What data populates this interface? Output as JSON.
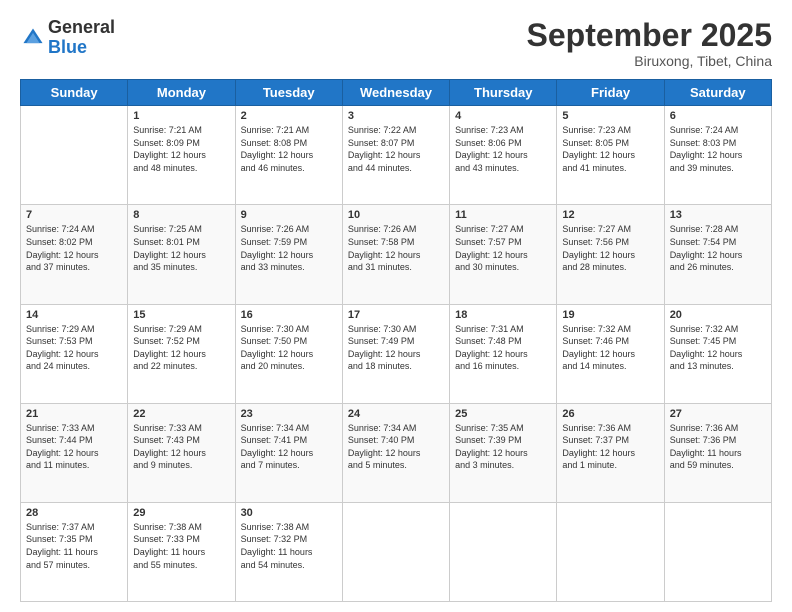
{
  "header": {
    "logo_general": "General",
    "logo_blue": "Blue",
    "month": "September 2025",
    "location": "Biruxong, Tibet, China"
  },
  "days_of_week": [
    "Sunday",
    "Monday",
    "Tuesday",
    "Wednesday",
    "Thursday",
    "Friday",
    "Saturday"
  ],
  "weeks": [
    [
      {
        "day": "",
        "info": ""
      },
      {
        "day": "1",
        "info": "Sunrise: 7:21 AM\nSunset: 8:09 PM\nDaylight: 12 hours\nand 48 minutes."
      },
      {
        "day": "2",
        "info": "Sunrise: 7:21 AM\nSunset: 8:08 PM\nDaylight: 12 hours\nand 46 minutes."
      },
      {
        "day": "3",
        "info": "Sunrise: 7:22 AM\nSunset: 8:07 PM\nDaylight: 12 hours\nand 44 minutes."
      },
      {
        "day": "4",
        "info": "Sunrise: 7:23 AM\nSunset: 8:06 PM\nDaylight: 12 hours\nand 43 minutes."
      },
      {
        "day": "5",
        "info": "Sunrise: 7:23 AM\nSunset: 8:05 PM\nDaylight: 12 hours\nand 41 minutes."
      },
      {
        "day": "6",
        "info": "Sunrise: 7:24 AM\nSunset: 8:03 PM\nDaylight: 12 hours\nand 39 minutes."
      }
    ],
    [
      {
        "day": "7",
        "info": "Sunrise: 7:24 AM\nSunset: 8:02 PM\nDaylight: 12 hours\nand 37 minutes."
      },
      {
        "day": "8",
        "info": "Sunrise: 7:25 AM\nSunset: 8:01 PM\nDaylight: 12 hours\nand 35 minutes."
      },
      {
        "day": "9",
        "info": "Sunrise: 7:26 AM\nSunset: 7:59 PM\nDaylight: 12 hours\nand 33 minutes."
      },
      {
        "day": "10",
        "info": "Sunrise: 7:26 AM\nSunset: 7:58 PM\nDaylight: 12 hours\nand 31 minutes."
      },
      {
        "day": "11",
        "info": "Sunrise: 7:27 AM\nSunset: 7:57 PM\nDaylight: 12 hours\nand 30 minutes."
      },
      {
        "day": "12",
        "info": "Sunrise: 7:27 AM\nSunset: 7:56 PM\nDaylight: 12 hours\nand 28 minutes."
      },
      {
        "day": "13",
        "info": "Sunrise: 7:28 AM\nSunset: 7:54 PM\nDaylight: 12 hours\nand 26 minutes."
      }
    ],
    [
      {
        "day": "14",
        "info": "Sunrise: 7:29 AM\nSunset: 7:53 PM\nDaylight: 12 hours\nand 24 minutes."
      },
      {
        "day": "15",
        "info": "Sunrise: 7:29 AM\nSunset: 7:52 PM\nDaylight: 12 hours\nand 22 minutes."
      },
      {
        "day": "16",
        "info": "Sunrise: 7:30 AM\nSunset: 7:50 PM\nDaylight: 12 hours\nand 20 minutes."
      },
      {
        "day": "17",
        "info": "Sunrise: 7:30 AM\nSunset: 7:49 PM\nDaylight: 12 hours\nand 18 minutes."
      },
      {
        "day": "18",
        "info": "Sunrise: 7:31 AM\nSunset: 7:48 PM\nDaylight: 12 hours\nand 16 minutes."
      },
      {
        "day": "19",
        "info": "Sunrise: 7:32 AM\nSunset: 7:46 PM\nDaylight: 12 hours\nand 14 minutes."
      },
      {
        "day": "20",
        "info": "Sunrise: 7:32 AM\nSunset: 7:45 PM\nDaylight: 12 hours\nand 13 minutes."
      }
    ],
    [
      {
        "day": "21",
        "info": "Sunrise: 7:33 AM\nSunset: 7:44 PM\nDaylight: 12 hours\nand 11 minutes."
      },
      {
        "day": "22",
        "info": "Sunrise: 7:33 AM\nSunset: 7:43 PM\nDaylight: 12 hours\nand 9 minutes."
      },
      {
        "day": "23",
        "info": "Sunrise: 7:34 AM\nSunset: 7:41 PM\nDaylight: 12 hours\nand 7 minutes."
      },
      {
        "day": "24",
        "info": "Sunrise: 7:34 AM\nSunset: 7:40 PM\nDaylight: 12 hours\nand 5 minutes."
      },
      {
        "day": "25",
        "info": "Sunrise: 7:35 AM\nSunset: 7:39 PM\nDaylight: 12 hours\nand 3 minutes."
      },
      {
        "day": "26",
        "info": "Sunrise: 7:36 AM\nSunset: 7:37 PM\nDaylight: 12 hours\nand 1 minute."
      },
      {
        "day": "27",
        "info": "Sunrise: 7:36 AM\nSunset: 7:36 PM\nDaylight: 11 hours\nand 59 minutes."
      }
    ],
    [
      {
        "day": "28",
        "info": "Sunrise: 7:37 AM\nSunset: 7:35 PM\nDaylight: 11 hours\nand 57 minutes."
      },
      {
        "day": "29",
        "info": "Sunrise: 7:38 AM\nSunset: 7:33 PM\nDaylight: 11 hours\nand 55 minutes."
      },
      {
        "day": "30",
        "info": "Sunrise: 7:38 AM\nSunset: 7:32 PM\nDaylight: 11 hours\nand 54 minutes."
      },
      {
        "day": "",
        "info": ""
      },
      {
        "day": "",
        "info": ""
      },
      {
        "day": "",
        "info": ""
      },
      {
        "day": "",
        "info": ""
      }
    ]
  ]
}
